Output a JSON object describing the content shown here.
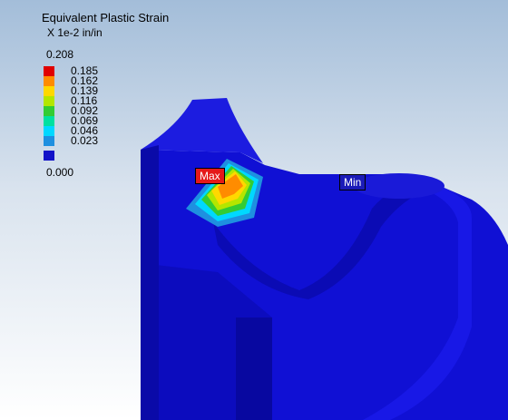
{
  "legend": {
    "title": "Equivalent Plastic Strain",
    "units": "X 1e-2 in/in",
    "max_value": "0.208",
    "min_value": "0.000",
    "bands": [
      {
        "label": "0.185",
        "color": "#e00000"
      },
      {
        "label": "0.162",
        "color": "#ff8c00"
      },
      {
        "label": "0.139",
        "color": "#ffd800"
      },
      {
        "label": "0.116",
        "color": "#b4e600"
      },
      {
        "label": "0.092",
        "color": "#33cc33"
      },
      {
        "label": "0.069",
        "color": "#00e0a0"
      },
      {
        "label": "0.046",
        "color": "#00d8ff"
      },
      {
        "label": "0.023",
        "color": "#1e90e0"
      },
      {
        "label": "",
        "color": "#1212c8"
      }
    ]
  },
  "probes": {
    "max_label": "Max",
    "min_label": "Min"
  },
  "colors": {
    "model_blue": "#0f0fd6",
    "background_top": "#a3bdd9",
    "background_bottom": "#ffffff"
  }
}
